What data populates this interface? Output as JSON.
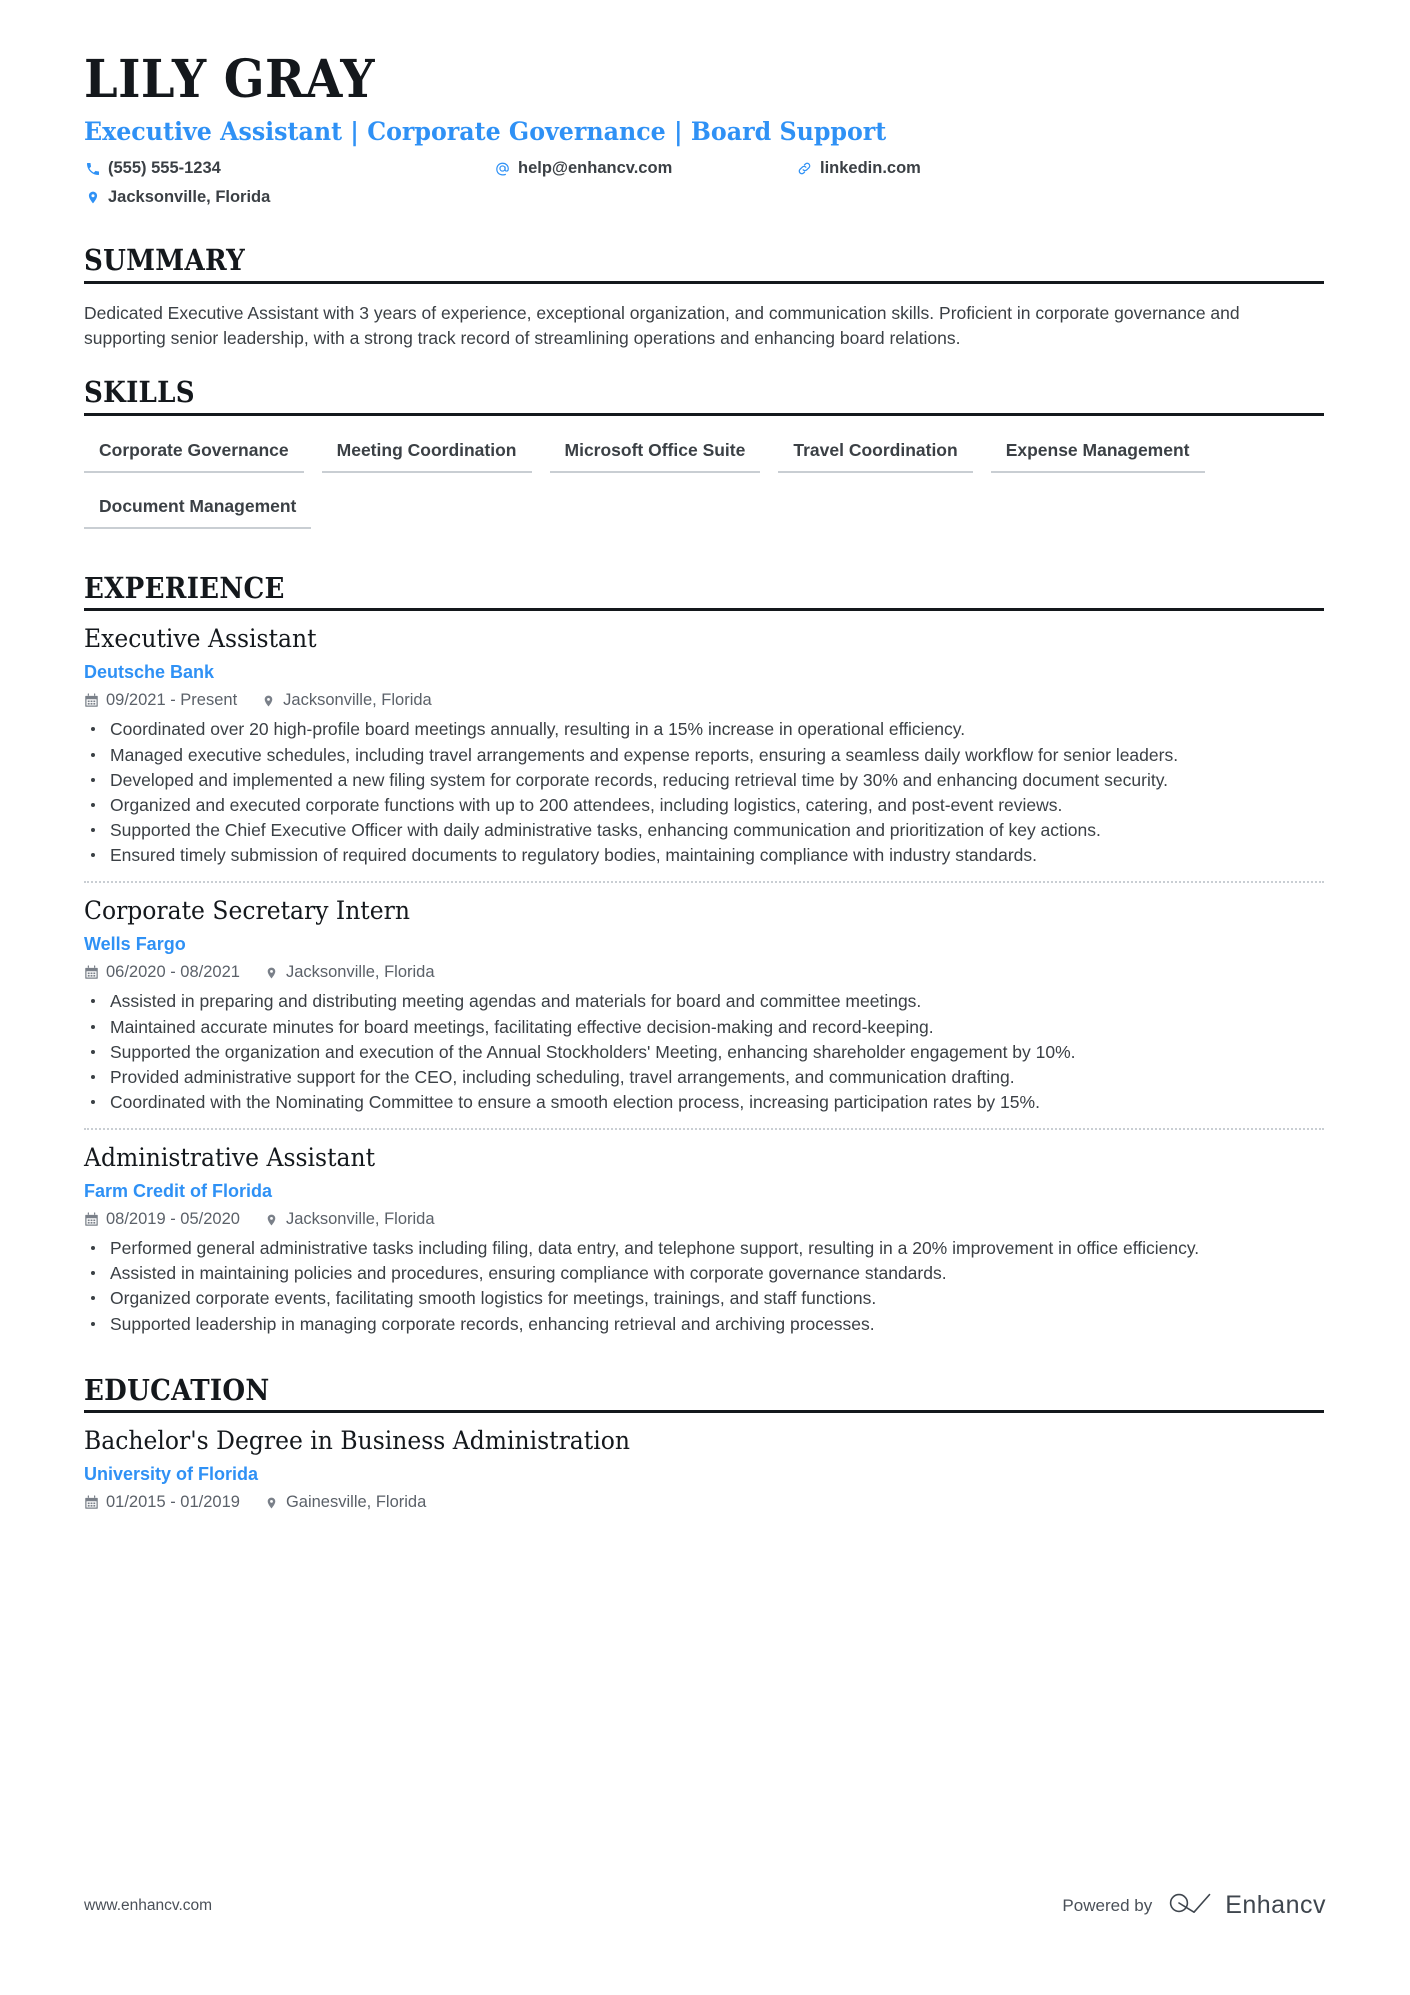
{
  "header": {
    "name": "LILY GRAY",
    "headline": "Executive Assistant | Corporate Governance | Board Support",
    "phone": "(555) 555-1234",
    "email": "help@enhancv.com",
    "website": "linkedin.com",
    "location": "Jacksonville, Florida"
  },
  "colors": {
    "accent": "#2f91f5",
    "text": "#3b4045",
    "heading": "#14181c",
    "muted": "#5b6169",
    "rule": "#c9ced3"
  },
  "summary": {
    "title": "SUMMARY",
    "text": "Dedicated Executive Assistant with 3 years of experience, exceptional organization, and communication skills. Proficient in corporate governance and supporting senior leadership, with a strong track record of streamlining operations and enhancing board relations."
  },
  "skills": {
    "title": "SKILLS",
    "items": [
      "Corporate Governance",
      "Meeting Coordination",
      "Microsoft Office Suite",
      "Travel Coordination",
      "Expense Management",
      "Document Management"
    ]
  },
  "experience": {
    "title": "EXPERIENCE",
    "entries": [
      {
        "role": "Executive Assistant",
        "company": "Deutsche Bank",
        "dates": "09/2021 - Present",
        "location": "Jacksonville, Florida",
        "bullets": [
          "Coordinated over 20 high-profile board meetings annually, resulting in a 15% increase in operational efficiency.",
          "Managed executive schedules, including travel arrangements and expense reports, ensuring a seamless daily workflow for senior leaders.",
          "Developed and implemented a new filing system for corporate records, reducing retrieval time by 30% and enhancing document security.",
          "Organized and executed corporate functions with up to 200 attendees, including logistics, catering, and post-event reviews.",
          "Supported the Chief Executive Officer with daily administrative tasks, enhancing communication and prioritization of key actions.",
          "Ensured timely submission of required documents to regulatory bodies, maintaining compliance with industry standards."
        ]
      },
      {
        "role": "Corporate Secretary Intern",
        "company": "Wells Fargo",
        "dates": "06/2020 - 08/2021",
        "location": "Jacksonville, Florida",
        "bullets": [
          "Assisted in preparing and distributing meeting agendas and materials for board and committee meetings.",
          "Maintained accurate minutes for board meetings, facilitating effective decision-making and record-keeping.",
          "Supported the organization and execution of the Annual Stockholders' Meeting, enhancing shareholder engagement by 10%.",
          "Provided administrative support for the CEO, including scheduling, travel arrangements, and communication drafting.",
          "Coordinated with the Nominating Committee to ensure a smooth election process, increasing participation rates by 15%."
        ]
      },
      {
        "role": "Administrative Assistant",
        "company": "Farm Credit of Florida",
        "dates": "08/2019 - 05/2020",
        "location": "Jacksonville, Florida",
        "bullets": [
          "Performed general administrative tasks including filing, data entry, and telephone support, resulting in a 20% improvement in office efficiency.",
          "Assisted in maintaining policies and procedures, ensuring compliance with corporate governance standards.",
          "Organized corporate events, facilitating smooth logistics for meetings, trainings, and staff functions.",
          "Supported leadership in managing corporate records, enhancing retrieval and archiving processes."
        ]
      }
    ]
  },
  "education": {
    "title": "EDUCATION",
    "entries": [
      {
        "degree": "Bachelor's Degree in Business Administration",
        "school": "University of Florida",
        "dates": "01/2015 - 01/2019",
        "location": "Gainesville, Florida"
      }
    ]
  },
  "footer": {
    "url": "www.enhancv.com",
    "powered_by": "Powered by",
    "brand": "Enhancv"
  }
}
